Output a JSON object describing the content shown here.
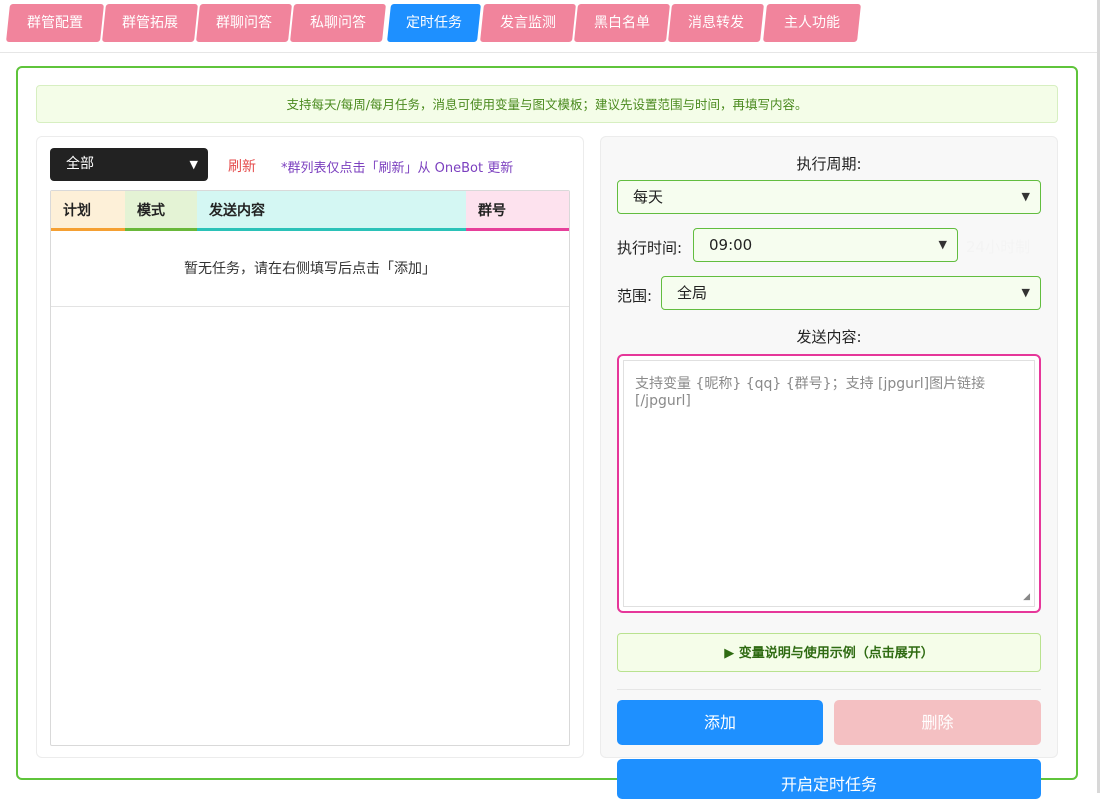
{
  "tabs": [
    {
      "label": "群管配置",
      "active": false
    },
    {
      "label": "群管拓展",
      "active": false
    },
    {
      "label": "群聊问答",
      "active": false
    },
    {
      "label": "私聊问答",
      "active": false
    },
    {
      "label": "定时任务",
      "active": true
    },
    {
      "label": "发言监测",
      "active": false
    },
    {
      "label": "黑白名单",
      "active": false
    },
    {
      "label": "消息转发",
      "active": false
    },
    {
      "label": "主人功能",
      "active": false
    }
  ],
  "notice": "支持每天/每周/每月任务，消息可使用变量与图文模板；建议先设置范围与时间，再填写内容。",
  "left": {
    "filter_value": "全部",
    "refresh_label": "刷新",
    "refresh_note": "*群列表仅点击「刷新」从 OneBot 更新",
    "table": {
      "columns": [
        "计划",
        "模式",
        "发送内容",
        "群号"
      ],
      "empty_text": "暂无任务，请在右侧填写后点击「添加」"
    }
  },
  "right": {
    "period_label": "执行周期:",
    "period_value": "每天",
    "time_label": "执行时间:",
    "time_value": "09:00",
    "time_hint": "24小时制",
    "scope_label": "范围:",
    "scope_value": "全局",
    "content_label": "发送内容:",
    "content_placeholder": "支持变量 {昵称} {qq} {群号}；支持 [jpgurl]图片链接[/jpgurl]",
    "vars_toggle": "▶ 变量说明与使用示例（点击展开）",
    "add_label": "添加",
    "delete_label": "删除",
    "open_label": "开启定时任务"
  },
  "colors": {
    "tab": "#f1849c",
    "tab_active": "#1e90ff",
    "accent_green": "#5fc43b",
    "refresh_red": "#e54b4b",
    "note_purple": "#7b3fbf",
    "content_border": "#e6379a"
  }
}
